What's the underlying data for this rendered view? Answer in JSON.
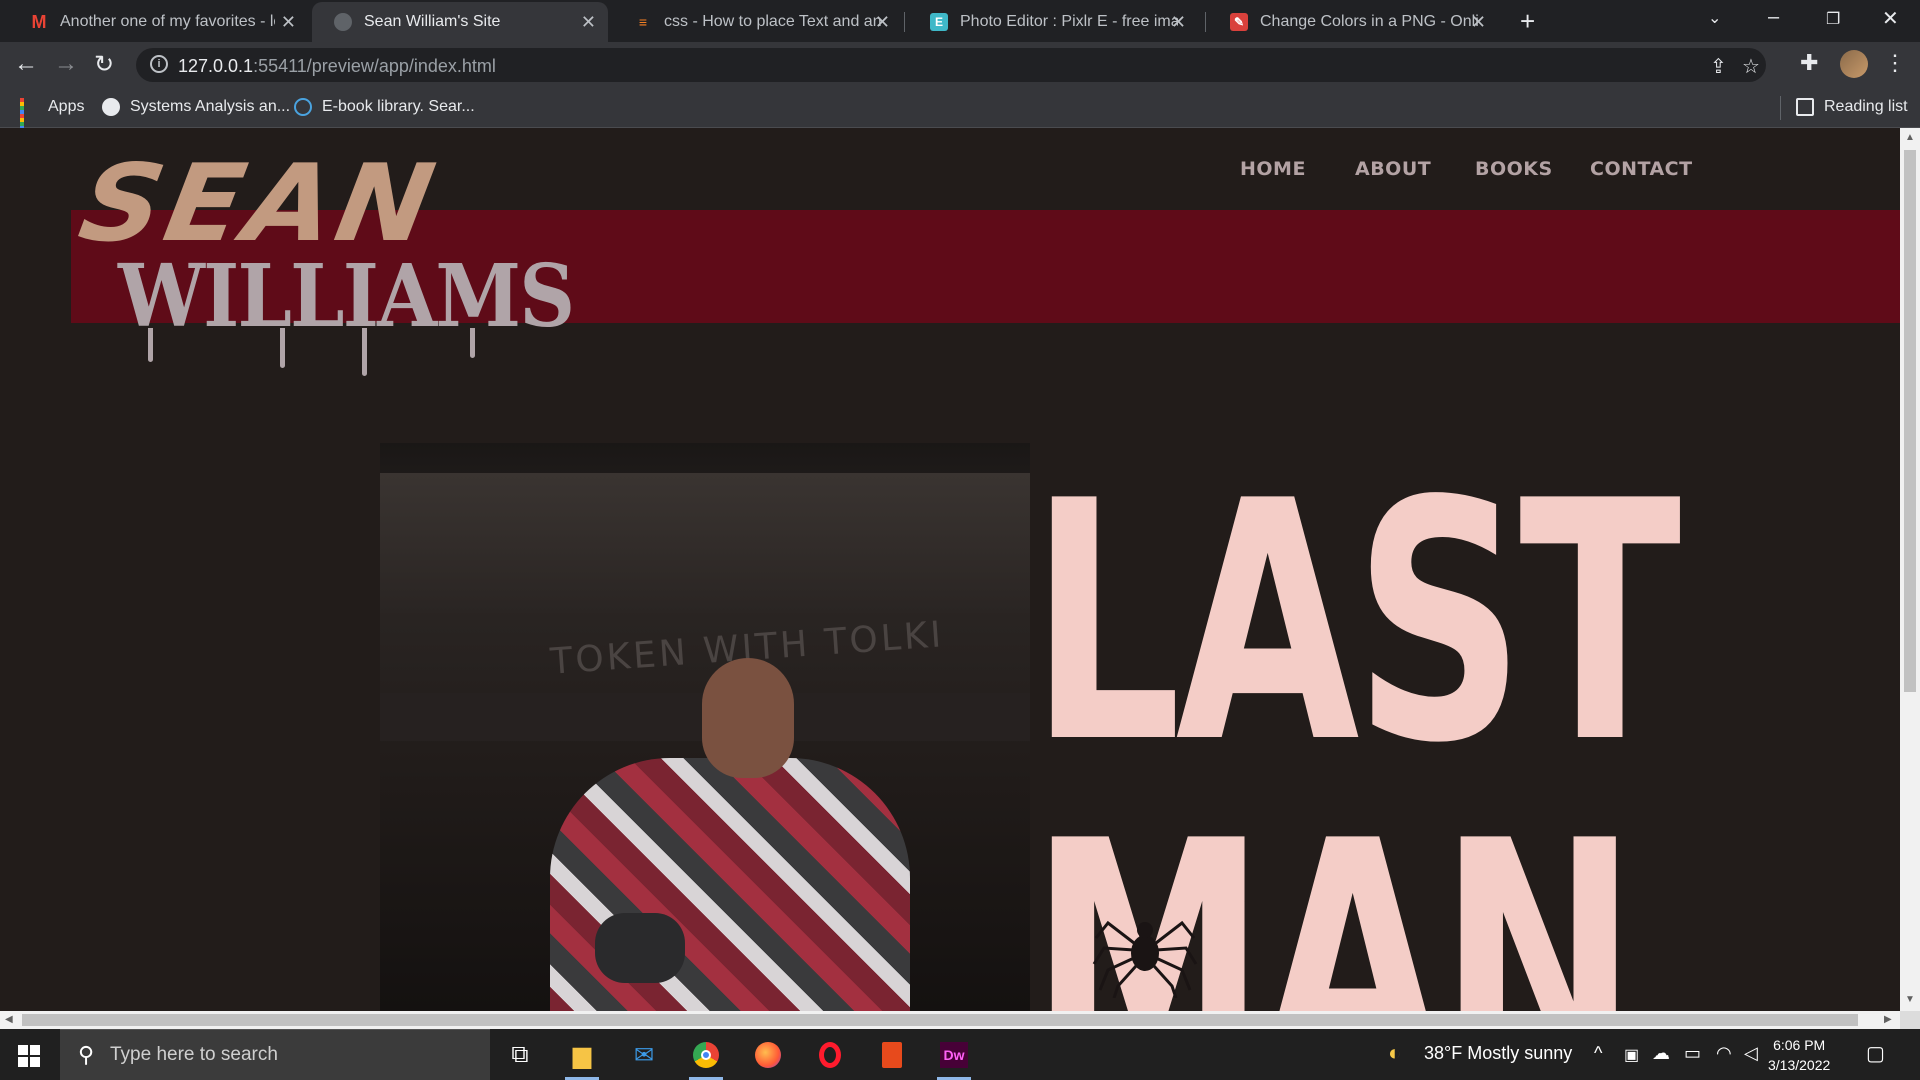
{
  "browser": {
    "tabs": [
      {
        "title": "Another one of my favorites - log",
        "favicon": "gmail-icon",
        "active": false
      },
      {
        "title": "Sean William's Site",
        "favicon": "globe-icon",
        "active": true
      },
      {
        "title": "css - How to place Text and an Im",
        "favicon": "stackoverflow-icon",
        "active": false
      },
      {
        "title": "Photo Editor : Pixlr E - free image",
        "favicon": "pixlr-icon",
        "active": false
      },
      {
        "title": "Change Colors in a PNG - Online",
        "favicon": "onlinepngtools-icon",
        "active": false
      }
    ],
    "url_host": "127.0.0.1",
    "url_rest": ":55411/preview/app/index.html",
    "bookmarks": [
      {
        "label": "Apps"
      },
      {
        "label": "Systems Analysis an..."
      },
      {
        "label": "E-book library. Sear..."
      }
    ],
    "reading_list": "Reading list"
  },
  "site": {
    "logo_top": "SEAN",
    "logo_bottom": "WILLIAMS",
    "nav": [
      "HOME",
      "ABOUT",
      "BOOKS",
      "CONTACT"
    ],
    "hero_line1": "LAST",
    "hero_line2": "MAN",
    "photo_graffiti_1": "TOKEN WITH TOLKI",
    "colors": {
      "banner": "#5f0b18",
      "background": "#221c1a",
      "title": "#f4cdc7",
      "nav": "#b3a2a4"
    }
  },
  "taskbar": {
    "search_placeholder": "Type here to search",
    "weather": "38°F  Mostly sunny",
    "time": "6:06 PM",
    "date": "3/13/2022",
    "apps": [
      "task-view-icon",
      "file-explorer-icon",
      "mail-icon",
      "chrome-icon",
      "firefox-icon",
      "opera-icon",
      "office-icon",
      "dreamweaver-icon"
    ]
  }
}
